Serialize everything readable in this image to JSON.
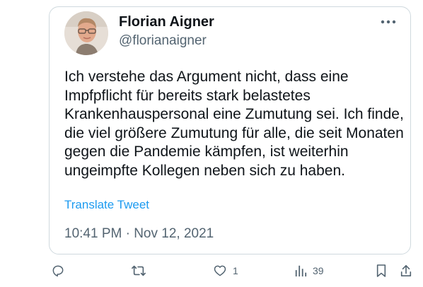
{
  "tweet": {
    "author_name": "Florian Aigner",
    "author_handle": "@florianaigner",
    "text": "Ich verstehe das Argument nicht, dass eine Impfpflicht für bereits stark belastetes Krankenhauspersonal eine Zumutung sei. Ich finde, die viel größere Zumutung für alle, die seit Monaten gegen die Pandemie kämpfen, ist weiterhin ungeimpfte Kollegen neben sich zu haben.",
    "translate_label": "Translate Tweet",
    "timestamp": "10:41 PM · Nov 12, 2021"
  },
  "actions": {
    "reply_icon": "reply-icon",
    "retweet_icon": "retweet-icon",
    "like_icon": "heart-icon",
    "like_count": "1",
    "views_icon": "views-icon",
    "views_count": "39",
    "bookmark_icon": "bookmark-icon",
    "share_icon": "share-icon"
  },
  "colors": {
    "link": "#1d9bf0",
    "text": "#0f1419",
    "secondary": "#536471",
    "border": "#cfd9de"
  }
}
